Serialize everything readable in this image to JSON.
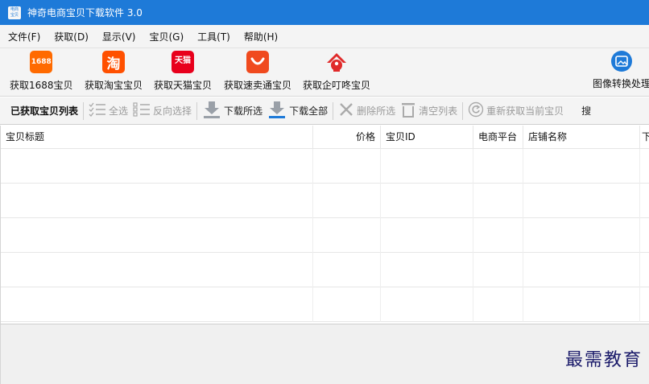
{
  "window": {
    "title": "神奇电商宝贝下载软件 3.0",
    "icon_text": "电商 宝贝"
  },
  "menu": [
    "文件(F)",
    "获取(D)",
    "显示(V)",
    "宝贝(G)",
    "工具(T)",
    "帮助(H)"
  ],
  "toolbar": {
    "buttons": [
      {
        "icon": "1688",
        "label": "获取1688宝贝"
      },
      {
        "icon": "淘",
        "label": "获取淘宝宝贝"
      },
      {
        "icon": "天猫",
        "label": "获取天猫宝贝"
      },
      {
        "icon": "aliexpress-icon",
        "label": "获取速卖通宝贝"
      },
      {
        "icon": "qidingdong-icon",
        "label": "获取企叮咚宝贝"
      }
    ],
    "image_convert": {
      "label": "图像转换处理"
    }
  },
  "subbar": {
    "title": "已获取宝贝列表",
    "select_all": "全选",
    "invert_select": "反向选择",
    "download_selected": "下载所选",
    "download_all": "下载全部",
    "delete_selected": "删除所选",
    "clear_list": "清空列表",
    "reacquire": "重新获取当前宝贝",
    "search": "搜"
  },
  "table": {
    "columns": [
      "宝贝标题",
      "价格",
      "宝贝ID",
      "电商平台",
      "店铺名称",
      "下"
    ],
    "rows": 5
  },
  "watermark": "最需教育",
  "colors": {
    "titlebar": "#1e7ad8",
    "panel": "#f4f4f4"
  }
}
